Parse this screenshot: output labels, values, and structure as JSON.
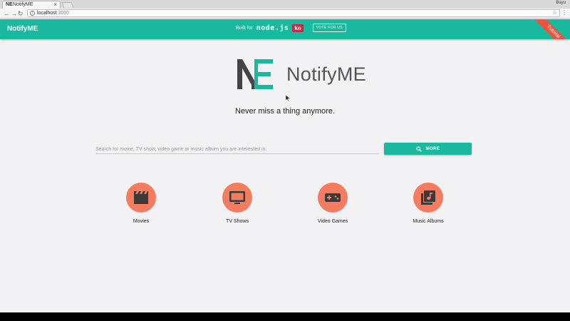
{
  "browser": {
    "tab_title": "NotifyME",
    "tab_favicon": "NE",
    "tab_close": "×",
    "url_host": "localhost",
    "url_port": ":3000",
    "profile": "Bayu"
  },
  "appbar": {
    "brand": "NotifyME",
    "built_for": "Built for",
    "node_logo": "node.js",
    "ko_badge": "ko",
    "vote_label": "VOTE FOR US",
    "ribbon": "Tutorial"
  },
  "hero": {
    "logo_text": "NotifyME",
    "tagline": "Never miss a thing anymore."
  },
  "search": {
    "placeholder": "Search for movie, TV show, video game or music album you are interested in.",
    "value": "",
    "button_label": "MORE",
    "button_icon": "search-icon"
  },
  "categories": [
    {
      "label": "Movies",
      "icon": "clapperboard-icon"
    },
    {
      "label": "TV Shows",
      "icon": "tv-icon"
    },
    {
      "label": "Video Games",
      "icon": "gamepad-icon"
    },
    {
      "label": "Music Albums",
      "icon": "music-library-icon"
    }
  ],
  "colors": {
    "accent": "#1ab99f",
    "category_circle": "#f47c61",
    "ribbon": "#f0523f",
    "ko_badge": "#c9283e",
    "background": "#f2f1f3"
  }
}
